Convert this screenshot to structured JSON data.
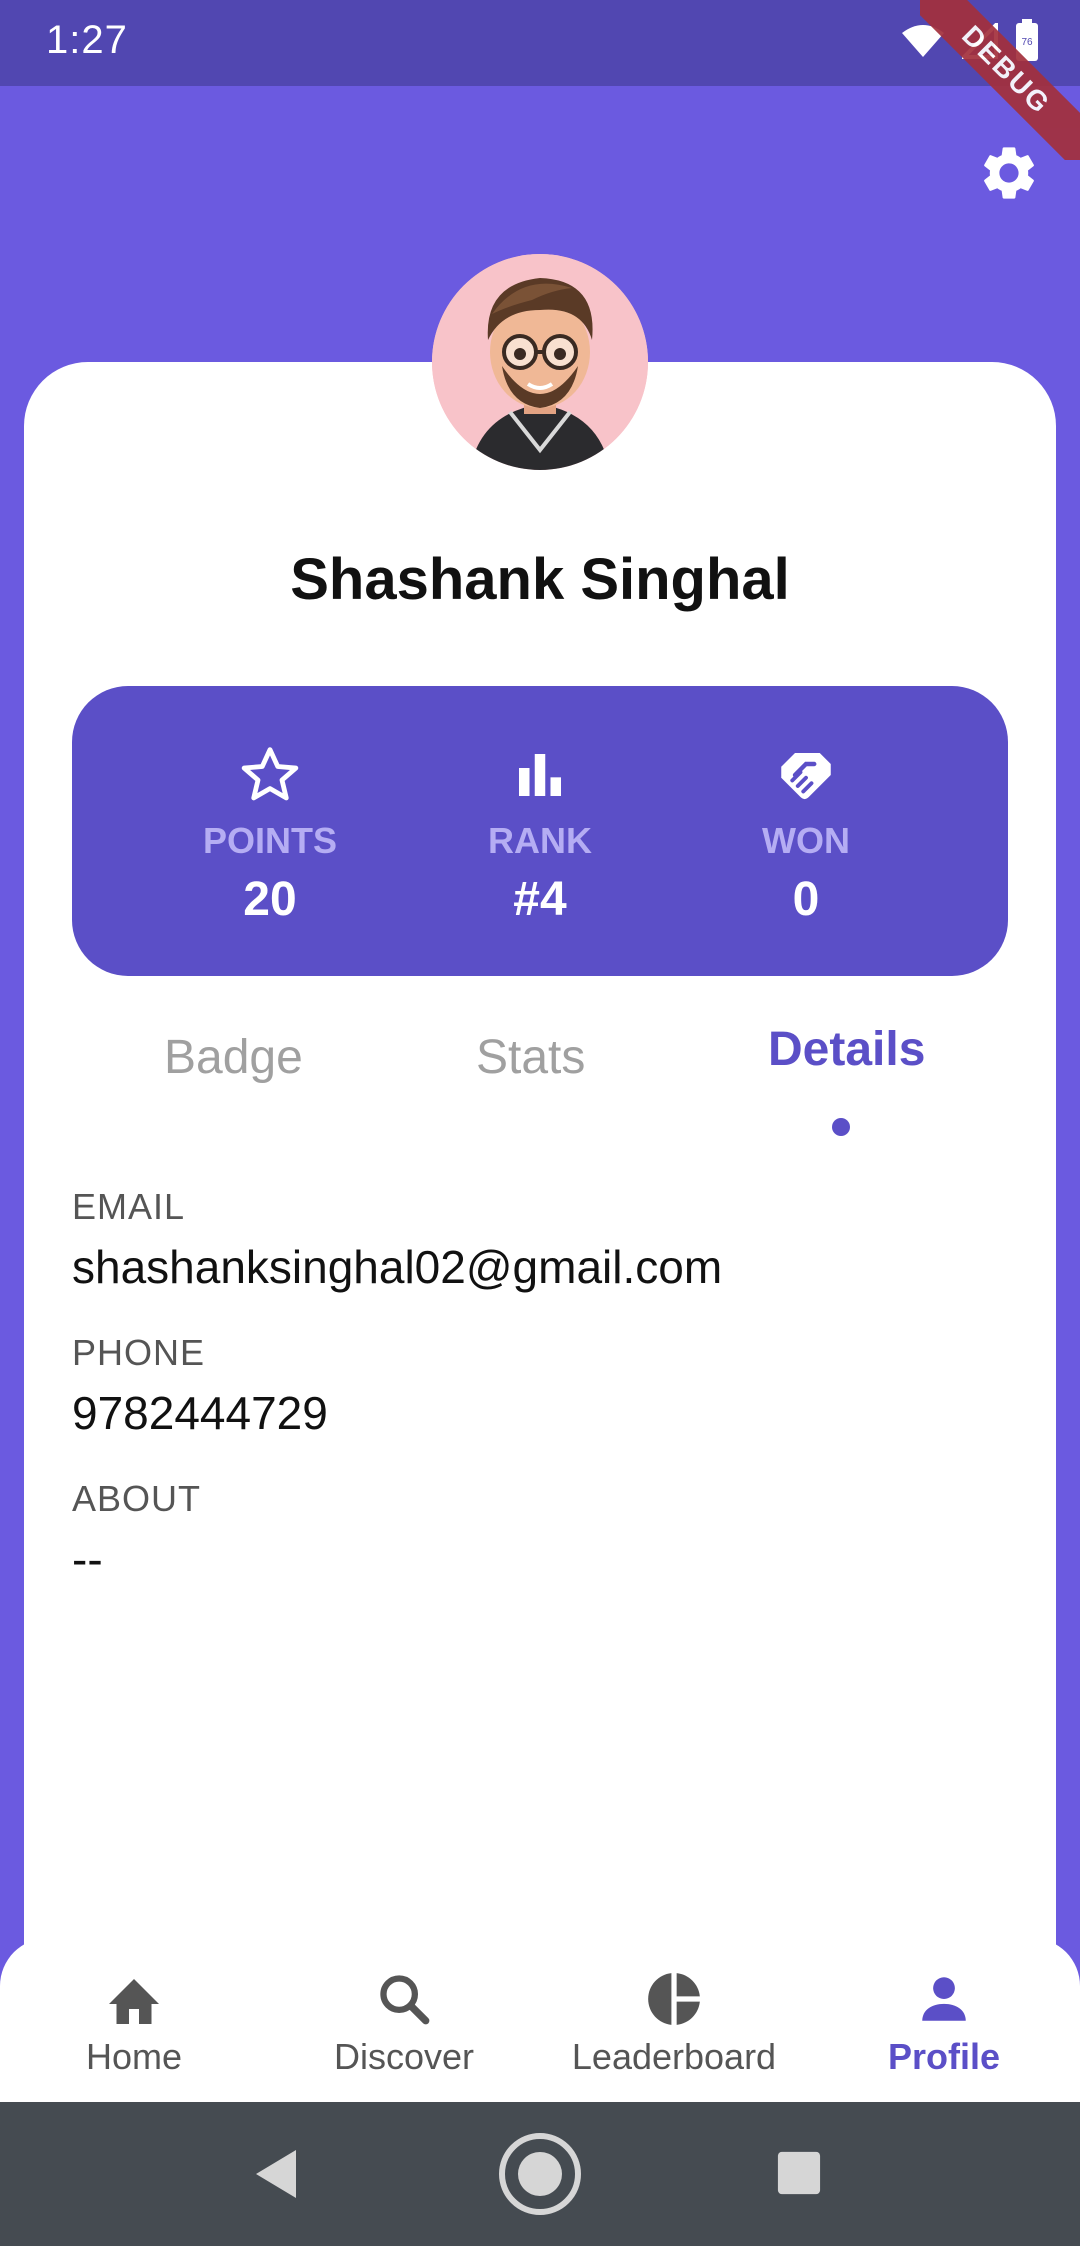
{
  "status_bar": {
    "time": "1:27",
    "battery_level": "76",
    "debug_label": "DEBUG"
  },
  "header": {
    "settings_icon": "gear-icon"
  },
  "profile": {
    "name": "Shashank Singhal",
    "avatar_icon": "avatar"
  },
  "stats": [
    {
      "icon": "star-outline-icon",
      "label": "POINTS",
      "value": "20"
    },
    {
      "icon": "bar-chart-icon",
      "label": "RANK",
      "value": "#4"
    },
    {
      "icon": "handshake-icon",
      "label": "WON",
      "value": "0"
    }
  ],
  "tabs": [
    {
      "label": "Badge",
      "active": false
    },
    {
      "label": "Stats",
      "active": false
    },
    {
      "label": "Details",
      "active": true
    }
  ],
  "details": {
    "email_label": "EMAIL",
    "email_value": "shashanksinghal02@gmail.com",
    "phone_label": "PHONE",
    "phone_value": "9782444729",
    "about_label": "ABOUT",
    "about_value": "--"
  },
  "bottom_nav": [
    {
      "label": "Home",
      "icon": "home-icon",
      "active": false
    },
    {
      "label": "Discover",
      "icon": "search-icon",
      "active": false
    },
    {
      "label": "Leaderboard",
      "icon": "pie-chart-icon",
      "active": false
    },
    {
      "label": "Profile",
      "icon": "person-icon",
      "active": true
    }
  ],
  "colors": {
    "primary": "#6b5ae0",
    "panel": "#5b4fc7",
    "status_bar": "#5147b1",
    "system_nav": "#454b51"
  }
}
